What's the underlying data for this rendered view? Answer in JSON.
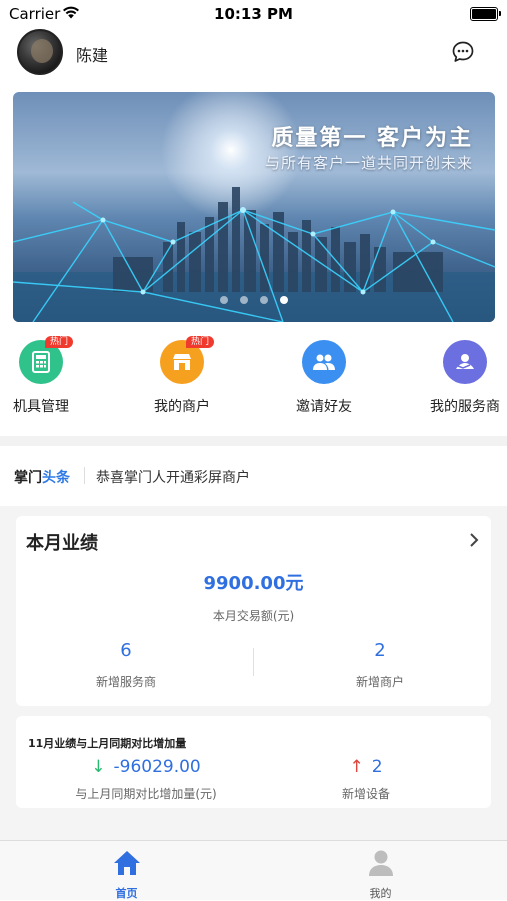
{
  "status_bar": {
    "carrier": "Carrier",
    "time": "10:13 PM"
  },
  "header": {
    "user_name": "陈建"
  },
  "banner": {
    "title": "质量第一  客户为主",
    "subtitle": "与所有客户一道共同开创未来",
    "slide_count": 4,
    "active_slide": 4
  },
  "quick_menu": [
    {
      "label": "机具管理",
      "badge": "热门",
      "icon": "calculator-icon",
      "color": "#2fc28a"
    },
    {
      "label": "我的商户",
      "badge": "热门",
      "icon": "shop-icon",
      "color": "#f6a020"
    },
    {
      "label": "邀请好友",
      "badge": "",
      "icon": "users-icon",
      "color": "#3b8ff0"
    },
    {
      "label": "我的服务商",
      "badge": "",
      "icon": "service-provider-icon",
      "color": "#6b6fe0"
    }
  ],
  "news": {
    "logo_a": "掌门",
    "logo_b": "头条",
    "text": "恭喜掌门人开通彩屏商户"
  },
  "monthly": {
    "title": "本月业绩",
    "amount": "9900.00元",
    "amount_label": "本月交易额(元)",
    "stats": [
      {
        "value": "6",
        "label": "新增服务商"
      },
      {
        "value": "2",
        "label": "新增商户"
      }
    ]
  },
  "compare": {
    "title": "11月业绩与上月同期对比增加量",
    "left_value": "-96029.00",
    "left_label": "与上月同期对比增加量(元)",
    "right_value": "2",
    "right_label": "新增设备"
  },
  "tabbar": [
    {
      "label": "首页",
      "active": true
    },
    {
      "label": "我的",
      "active": false
    }
  ]
}
